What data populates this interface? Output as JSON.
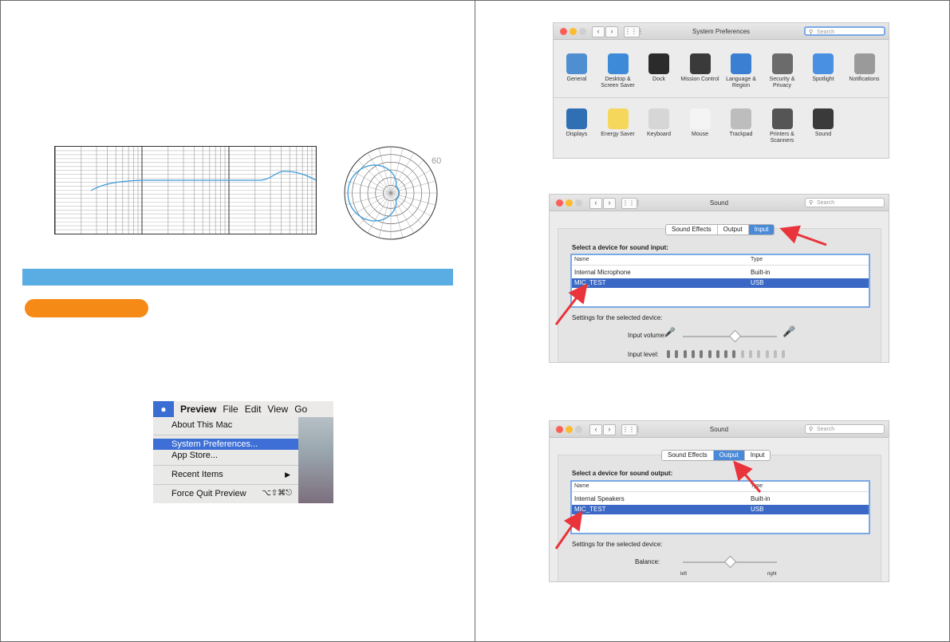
{
  "polar_chart": {
    "label": "60"
  },
  "mac_menu": {
    "app_name": "Preview",
    "menus": [
      "File",
      "Edit",
      "View",
      "Go"
    ],
    "items": [
      {
        "label": "About This Mac"
      },
      {
        "label": "System Preferences..."
      },
      {
        "label": "App Store..."
      },
      {
        "label": "Recent Items"
      },
      {
        "label": "Force Quit Preview",
        "shortcut": "⌥⇧⌘⎋"
      }
    ],
    "selected": "System Preferences..."
  },
  "system_prefs_window": {
    "title": "System Preferences",
    "search_placeholder": "Search",
    "row1": [
      {
        "label": "General",
        "color": "#4f8fd1"
      },
      {
        "label": "Desktop & Screen Saver",
        "color": "#3d8bd8"
      },
      {
        "label": "Dock",
        "color": "#2b2b2b"
      },
      {
        "label": "Mission Control",
        "color": "#3a3a3a"
      },
      {
        "label": "Language & Region",
        "color": "#3b7fd2"
      },
      {
        "label": "Security & Privacy",
        "color": "#6b6b6b"
      },
      {
        "label": "Spotlight",
        "color": "#4a90e2"
      },
      {
        "label": "Notifications",
        "color": "#9a9a9a"
      }
    ],
    "row2": [
      {
        "label": "Displays",
        "color": "#2f6fb4"
      },
      {
        "label": "Energy Saver",
        "color": "#f5d85b"
      },
      {
        "label": "Keyboard",
        "color": "#d6d6d6"
      },
      {
        "label": "Mouse",
        "color": "#f4f4f4"
      },
      {
        "label": "Trackpad",
        "color": "#bdbdbd"
      },
      {
        "label": "Printers & Scanners",
        "color": "#555555"
      },
      {
        "label": "Sound",
        "color": "#3a3a3a"
      }
    ]
  },
  "sound_input_window": {
    "title": "Sound",
    "search_placeholder": "Search",
    "tabs": [
      "Sound Effects",
      "Output",
      "Input"
    ],
    "active_tab": "Input",
    "section_label": "Select a device for sound input:",
    "columns": [
      "Name",
      "Type"
    ],
    "rows": [
      {
        "name": "Internal Microphone",
        "type": "Built-in"
      },
      {
        "name": "MIC_TEST",
        "type": "USB",
        "selected": true
      }
    ],
    "settings_label": "Settings for the selected device:",
    "input_volume_label": "Input volume:",
    "input_volume": 0.55,
    "input_level_label": "Input level:",
    "input_level_lit": 9,
    "input_level_total": 15
  },
  "sound_output_window": {
    "title": "Sound",
    "search_placeholder": "Search",
    "tabs": [
      "Sound Effects",
      "Output",
      "Input"
    ],
    "active_tab": "Output",
    "section_label": "Select a device for sound output:",
    "columns": [
      "Name",
      "Type"
    ],
    "rows": [
      {
        "name": "Internal Speakers",
        "type": "Built-in"
      },
      {
        "name": "MIC_TEST",
        "type": "USB",
        "selected": true
      }
    ],
    "settings_label": "Settings for the selected device:",
    "balance_label": "Balance:",
    "balance": 0.5,
    "balance_left": "left",
    "balance_right": "right"
  },
  "colors": {
    "blue_bar": "#5aade2",
    "orange_pill": "#f58a17",
    "selection": "#3b68c4",
    "arrow": "#e8343a",
    "curve": "#3b9ad8"
  }
}
